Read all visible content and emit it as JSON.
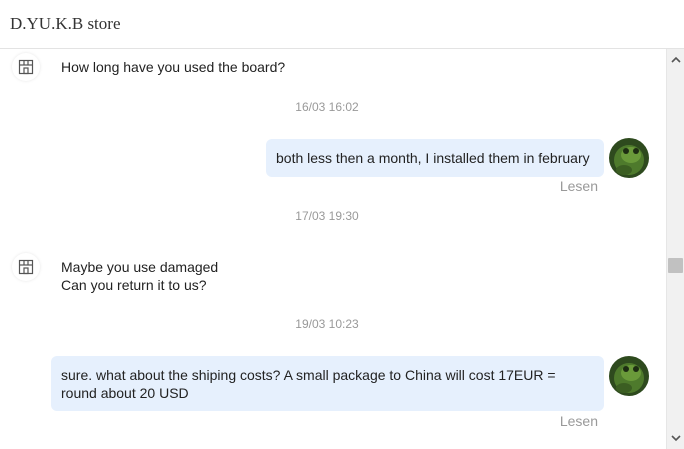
{
  "header": {
    "title": "D.YU.K.B store"
  },
  "messages": [
    {
      "from": "store",
      "lines": [
        "How long have you used the board?"
      ]
    },
    {
      "timestamp": "16/03 16:02"
    },
    {
      "from": "user",
      "lines": [
        "both less then a month, I installed them in february"
      ],
      "status": "Lesen"
    },
    {
      "timestamp": "17/03 19:30"
    },
    {
      "from": "store",
      "lines": [
        "Maybe you use damaged",
        "Can you return it to us?"
      ]
    },
    {
      "timestamp": "19/03 10:23"
    },
    {
      "from": "user",
      "lines": [
        "sure. what about the shiping costs? A small package to China will cost 17EUR =",
        "round about 20 USD"
      ],
      "status": "Lesen"
    }
  ],
  "colors": {
    "outgoing_bubble": "#e6f0fd",
    "muted_text": "#999999"
  },
  "icons": {
    "store": "store-icon",
    "avatar": "frog-avatar",
    "scroll_up": "chevron-up-icon",
    "scroll_down": "chevron-down-icon"
  }
}
